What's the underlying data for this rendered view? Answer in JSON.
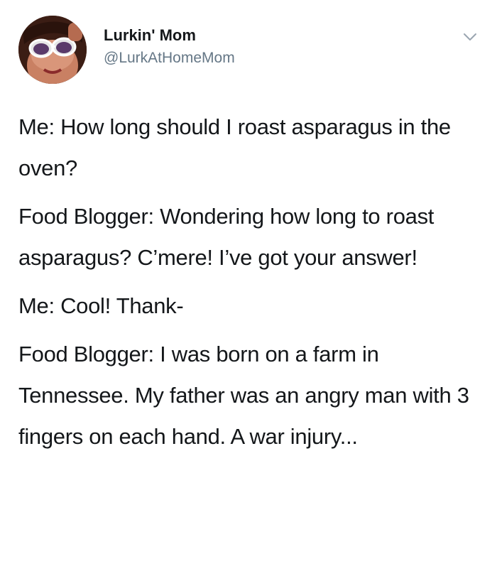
{
  "tweet": {
    "display_name": "Lurkin' Mom",
    "handle": "@LurkAtHomeMom",
    "paragraphs": [
      "Me: How long should I roast asparagus in the oven?",
      "Food Blogger: Wondering how long to roast asparagus? C’mere! I’ve got your answer!",
      "Me: Cool! Thank-",
      "Food Blogger: I was born on a farm in Tennessee. My father was an angry man with 3 fingers on each hand. A war injury..."
    ]
  },
  "icons": {
    "avatar": "profile-photo",
    "menu": "chevron-down-icon"
  },
  "colors": {
    "text": "#14171a",
    "secondary": "#657786",
    "background": "#ffffff"
  }
}
